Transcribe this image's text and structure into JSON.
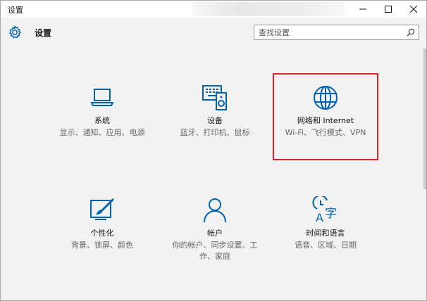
{
  "window": {
    "title": "设置"
  },
  "header": {
    "title": "设置",
    "search_placeholder": "查找设置"
  },
  "tiles": [
    {
      "label": "系统",
      "desc": "显示、通知、应用、电源",
      "icon": "laptop-icon"
    },
    {
      "label": "设备",
      "desc": "蓝牙、打印机、鼠标",
      "icon": "keyboard-speaker-icon"
    },
    {
      "label": "网络和 Internet",
      "desc": "Wi-Fi、飞行模式、VPN",
      "icon": "globe-icon"
    },
    {
      "label": "个性化",
      "desc": "背景、锁屏、颜色",
      "icon": "paint-brush-icon"
    },
    {
      "label": "帐户",
      "desc": "你的帐户、同步设置、工作、家庭",
      "icon": "person-icon"
    },
    {
      "label": "时间和语言",
      "desc": "语音、区域、日期",
      "icon": "time-language-icon"
    }
  ],
  "colors": {
    "accent": "#0063b1",
    "highlight": "#d9262c"
  }
}
